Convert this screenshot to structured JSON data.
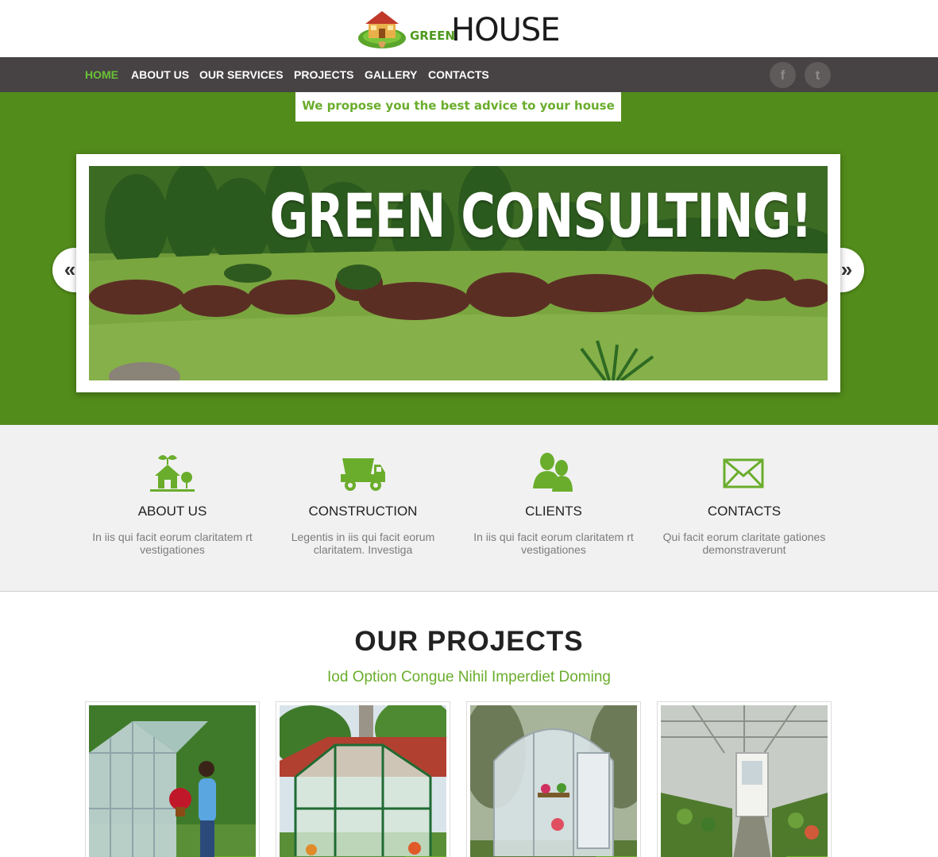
{
  "brand": {
    "logo_green": "GREEN",
    "logo_house": "HOUSE"
  },
  "nav": {
    "items": [
      {
        "label": "HOME",
        "active": true
      },
      {
        "label": "ABOUT US",
        "active": false
      },
      {
        "label": "OUR SERVICES",
        "active": false
      },
      {
        "label": "PROJECTS",
        "active": false
      },
      {
        "label": "GALLERY",
        "active": false
      },
      {
        "label": "CONTACTS",
        "active": false
      }
    ],
    "social": [
      {
        "icon": "facebook-icon",
        "glyph": "f"
      },
      {
        "icon": "twitter-icon",
        "glyph": "t"
      }
    ]
  },
  "hero": {
    "tagline": "We propose you the best advice to your house",
    "slide_title": "GREEN CONSULTING!",
    "prev_glyph": "«",
    "next_glyph": "»"
  },
  "features": [
    {
      "icon": "house-tree-icon",
      "title": "ABOUT US",
      "text": "In iis qui facit eorum claritatem rt vestigationes"
    },
    {
      "icon": "dump-truck-icon",
      "title": "CONSTRUCTION",
      "text": "Legentis in iis qui facit eorum claritatem. Investiga"
    },
    {
      "icon": "users-icon",
      "title": "CLIENTS",
      "text": "In iis qui facit eorum claritatem rt vestigationes"
    },
    {
      "icon": "envelope-icon",
      "title": "CONTACTS",
      "text": "Qui facit eorum claritate gationes demonstraverunt"
    }
  ],
  "projects": {
    "title": "OUR PROJECTS",
    "subtitle": "Iod Option Congue Nihil Imperdiet Doming",
    "items": [
      {
        "image": "greenhouse-woman-image"
      },
      {
        "image": "greenhouse-garden-image"
      },
      {
        "image": "greenhouse-arched-image"
      },
      {
        "image": "greenhouse-interior-image"
      }
    ]
  },
  "colors": {
    "accent": "#6aad2c",
    "nav_bg": "#474344",
    "hero_bg": "#528c1a",
    "features_bg": "#f1f1f1"
  }
}
